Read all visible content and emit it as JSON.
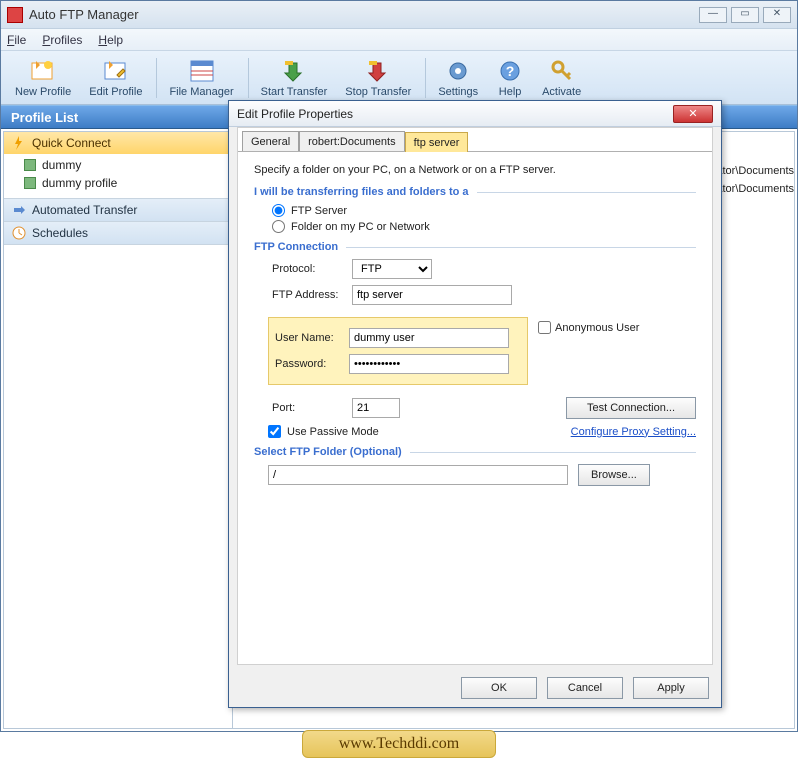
{
  "app": {
    "title": "Auto FTP Manager"
  },
  "menu": {
    "file": "File",
    "profiles": "Profiles",
    "help": "Help"
  },
  "toolbar": {
    "new_profile": "New Profile",
    "edit_profile": "Edit Profile",
    "file_manager": "File Manager",
    "start_transfer": "Start Transfer",
    "stop_transfer": "Stop Transfer",
    "settings": "Settings",
    "help": "Help",
    "activate": "Activate"
  },
  "panel": {
    "title": "Profile List"
  },
  "sidebar": {
    "quick_connect": "Quick Connect",
    "items": [
      "dummy",
      "dummy profile"
    ],
    "automated_transfer": "Automated Transfer",
    "schedules": "Schedules"
  },
  "right": {
    "line1": "inistrator\\Documents",
    "line2": "inistrator\\Documents"
  },
  "dialog": {
    "title": "Edit Profile Properties",
    "tabs": {
      "general": "General",
      "robert": "robert:Documents",
      "ftp": "ftp server"
    },
    "instr": "Specify a folder on your PC, on a Network or on a  FTP server.",
    "grp_transfer": "I will be transferring files and folders to a",
    "radio_ftp": "FTP Server",
    "radio_folder": "Folder on my PC or Network",
    "grp_conn": "FTP Connection",
    "protocol_label": "Protocol:",
    "protocol_value": "FTP",
    "addr_label": "FTP Address:",
    "addr_value": "ftp server",
    "user_label": "User Name:",
    "user_value": "dummy user",
    "pass_label": "Password:",
    "pass_value": "••••••••••••",
    "anon": "Anonymous User",
    "port_label": "Port:",
    "port_value": "21",
    "test_btn": "Test Connection...",
    "passive": "Use Passive Mode",
    "proxy": "Configure Proxy Setting...",
    "grp_folder": "Select FTP Folder (Optional)",
    "folder_value": "/",
    "browse": "Browse...",
    "ok": "OK",
    "cancel": "Cancel",
    "apply": "Apply"
  },
  "watermark": "www.Techddi.com"
}
